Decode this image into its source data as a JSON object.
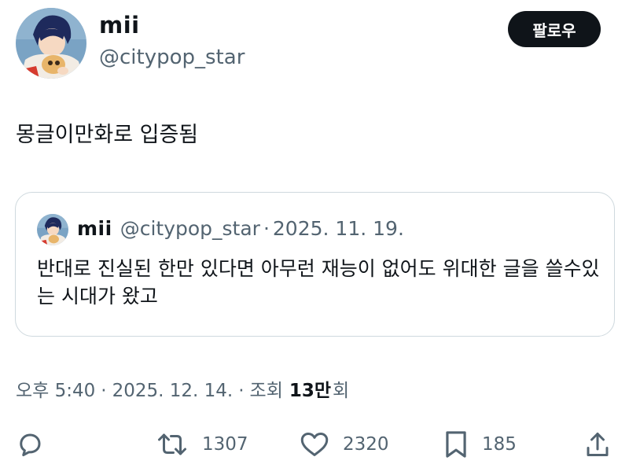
{
  "author": {
    "display_name": "mii",
    "handle": "@citypop_star"
  },
  "follow_button": {
    "label": "팔로우"
  },
  "tweet": {
    "text": "몽글이만화로 입증됨"
  },
  "quoted_tweet": {
    "display_name": "mii",
    "handle": "@citypop_star",
    "separator": "·",
    "date": "2025. 11. 19.",
    "text": "반대로 진실된 한만 있다면 아무런 재능이 없어도 위대한 글을 쓸수있는 시대가 왔고"
  },
  "meta": {
    "time": "오후 5:40",
    "separator": "·",
    "date": "2025. 12. 14.",
    "separator2": "·",
    "views_label": "조회",
    "views_count": "13만",
    "views_suffix": "회"
  },
  "actions": {
    "reply": {
      "icon": "reply-icon"
    },
    "retweet": {
      "icon": "retweet-icon",
      "count": "1307"
    },
    "like": {
      "icon": "heart-icon",
      "count": "2320"
    },
    "bookmark": {
      "icon": "bookmark-icon",
      "count": "185"
    },
    "share": {
      "icon": "share-icon"
    }
  },
  "colors": {
    "text": "#0f1419",
    "secondary": "#536471",
    "border": "#cfd9de",
    "button_bg": "#0f1419"
  }
}
